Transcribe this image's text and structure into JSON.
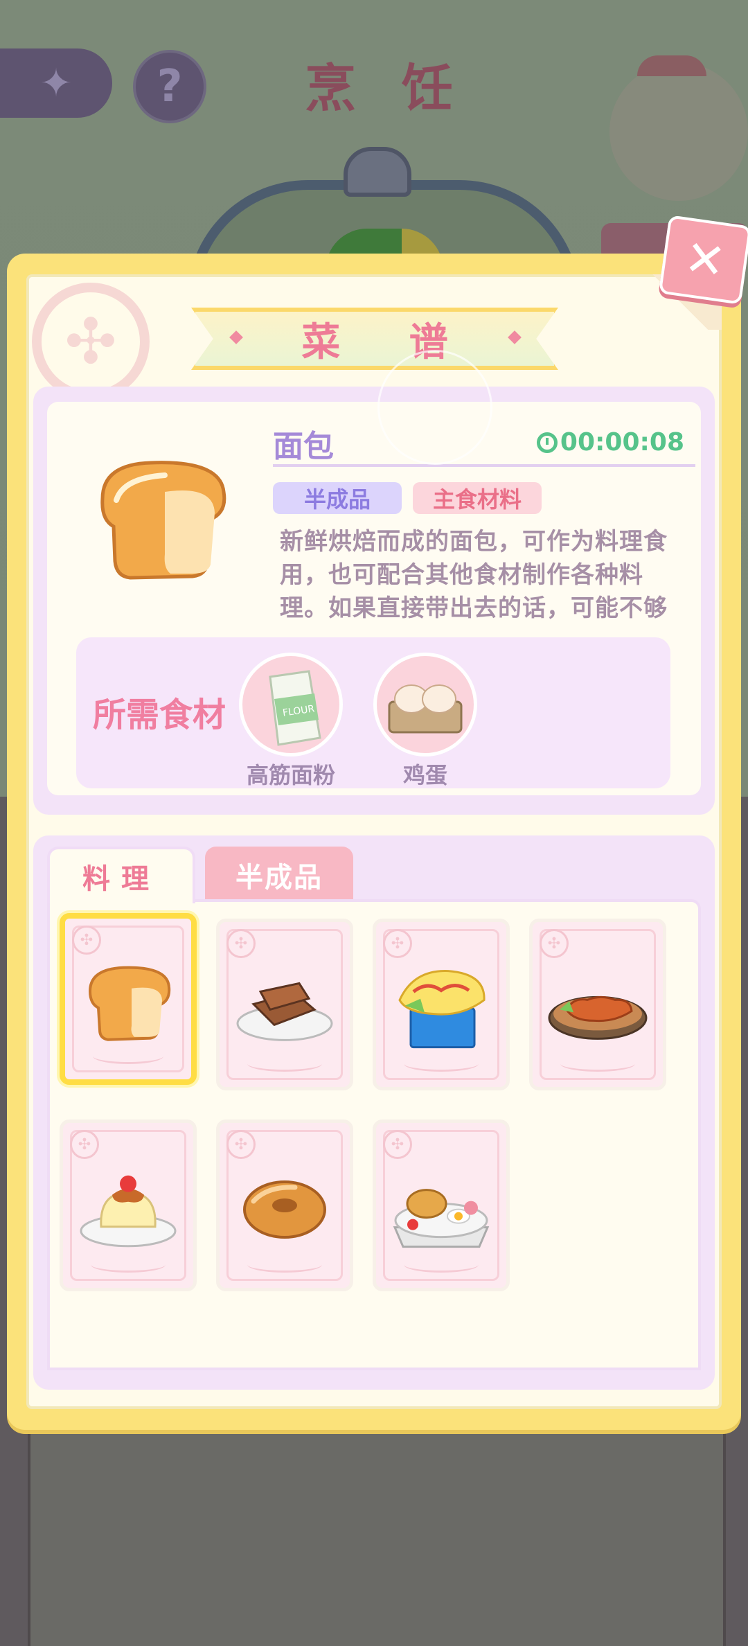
{
  "background": {
    "title": "烹 饪",
    "help_label": "?"
  },
  "popup": {
    "title": "菜 谱",
    "close_label": "✕"
  },
  "selected_item": {
    "name": "面包",
    "timer": "00:00:08",
    "tags": [
      "半成品",
      "主食材料"
    ],
    "description": "新鲜烘焙而成的面包，可作为料理食用，也可配合其他食材制作各种料理。如果直接带出去的话，可能不够三",
    "ingredients_label": "所需食材",
    "ingredients": [
      {
        "name": "高筋面粉",
        "icon": "flour-bag-icon"
      },
      {
        "name": "鸡蛋",
        "icon": "egg-carton-icon"
      }
    ]
  },
  "tabs": [
    {
      "label": "料理",
      "active": true
    },
    {
      "label": "半成品",
      "active": false
    }
  ],
  "recipes": [
    {
      "icon": "bread-icon",
      "selected": true
    },
    {
      "icon": "toast-plate-icon",
      "selected": false
    },
    {
      "icon": "omelette-box-icon",
      "selected": false
    },
    {
      "icon": "glazed-meat-plate-icon",
      "selected": false
    },
    {
      "icon": "strawberry-pudding-icon",
      "selected": false
    },
    {
      "icon": "donut-icon",
      "selected": false
    },
    {
      "icon": "breakfast-platter-icon",
      "selected": false
    }
  ],
  "colors": {
    "frame_yellow": "#fbe27a",
    "title_pink": "#ee7b96",
    "name_purple": "#a58ad8",
    "timer_green": "#56c38a"
  }
}
